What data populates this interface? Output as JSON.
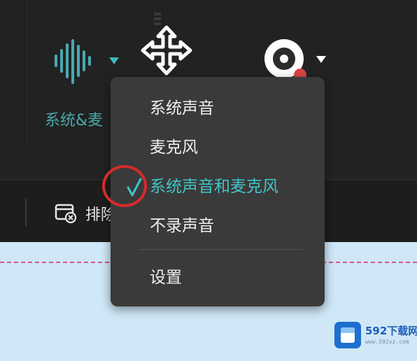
{
  "toolbar": {
    "audio_source_label": "系统&麦"
  },
  "secondary_bar": {
    "exclude_label": "排除"
  },
  "audio_menu": {
    "items": [
      {
        "label": "系统声音",
        "checked": false
      },
      {
        "label": "麦克风",
        "checked": false
      },
      {
        "label": "系统声音和麦克风",
        "checked": true
      },
      {
        "label": "不录声音",
        "checked": false
      }
    ],
    "settings_label": "设置"
  },
  "watermark": {
    "brand": "592下载网",
    "url": "www.592xz.com"
  },
  "colors": {
    "accent": "#41c5c8",
    "highlight": "#d52b2b"
  },
  "icons": {
    "audio": "waveform-icon",
    "move": "move-arrows-icon",
    "camera": "webcam-icon",
    "check": "checkmark-icon"
  }
}
